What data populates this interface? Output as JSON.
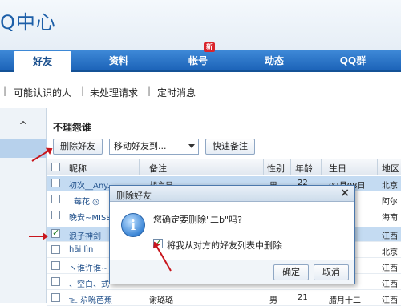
{
  "app": {
    "title": "Q中心"
  },
  "nav": {
    "tabs": [
      {
        "label": "好友"
      },
      {
        "label": "资料"
      },
      {
        "label": "帐号",
        "badge": "新"
      },
      {
        "label": "动态"
      },
      {
        "label": "QQ群"
      }
    ]
  },
  "subnav": {
    "items": [
      "可能认识的人",
      "未处理请求",
      "定时消息"
    ]
  },
  "sidebar": {
    "collapse_symbol": "^"
  },
  "group": {
    "title": "不理怨谁",
    "delete_button": "删除好友",
    "move_select": "移动好友到...",
    "quick_remark_button": "快速备注"
  },
  "table": {
    "columns": [
      "昵称",
      "备注",
      "性别",
      "年龄",
      "生日",
      "地区"
    ],
    "rows": [
      {
        "nickname": "初次__Any...",
        "remark": "胡言显",
        "gender": "男",
        "age": "22",
        "birthday": "02月08日",
        "region": "北京"
      },
      {
        "nickname": "莓花 ◎",
        "remark": "",
        "gender": "",
        "age": "",
        "birthday": "",
        "region": "阿尔"
      },
      {
        "nickname": "晚安~MISS",
        "remark": "",
        "gender": "",
        "age": "",
        "birthday": "",
        "region": "海南"
      },
      {
        "nickname": "浪子神剑",
        "remark": "",
        "gender": "",
        "age": "",
        "birthday": "",
        "region": "江西"
      },
      {
        "nickname": "hāi lìn",
        "remark": "",
        "gender": "",
        "age": "",
        "birthday": "",
        "region": "北京"
      },
      {
        "nickname": "ヽ谁许谁~",
        "remark": "",
        "gender": "",
        "age": "",
        "birthday": "",
        "region": "江西"
      },
      {
        "nickname": "、空白、式",
        "remark": "",
        "gender": "",
        "age": "",
        "birthday": "",
        "region": "江西"
      },
      {
        "nickname": "℡ 尕吮芭蕉",
        "remark": "谢璐璐",
        "gender": "男",
        "age": "21",
        "birthday": "腊月十二",
        "region": "江西"
      }
    ]
  },
  "dialog": {
    "title": "删除好友",
    "close_symbol": "×",
    "message": "您确定要删除\"二b\"吗?",
    "checkbox_label": "将我从对方的好友列表中删除",
    "confirm_button": "确定",
    "cancel_button": "取消",
    "icon_symbol": "i"
  }
}
